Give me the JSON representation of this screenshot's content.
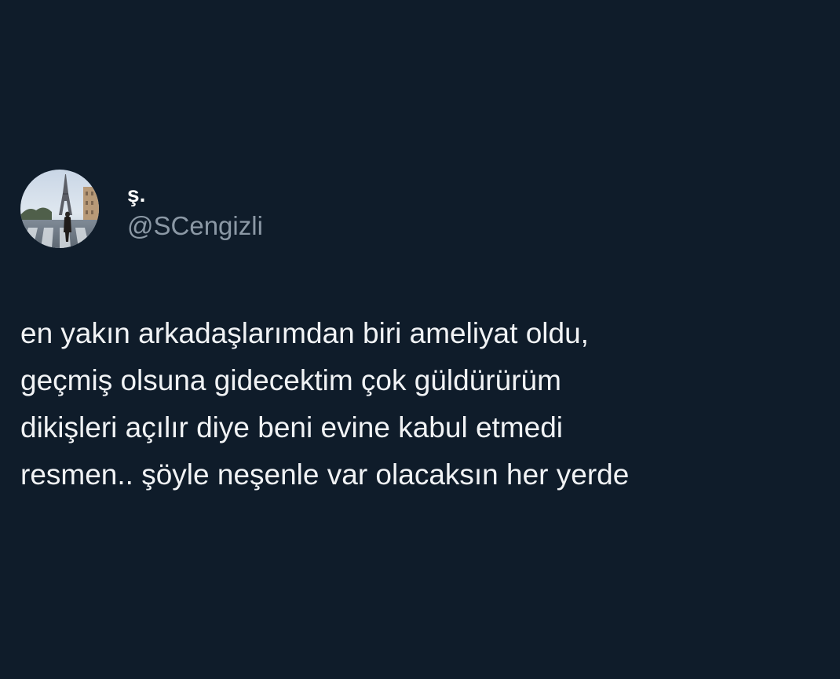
{
  "tweet": {
    "display_name": "ş.",
    "handle": "@SCengizli",
    "text": "en yakın arkadaşlarımdan biri ameliyat oldu,\ngeçmiş olsuna gidecektim çok güldürürüm\ndikişleri açılır diye beni evine kabul etmedi\nresmen.. şöyle neşenle var olacaksın her yerde"
  },
  "theme": {
    "background": "#0f1c2a",
    "text_color": "#f1f3f5",
    "handle_color": "#8b98a5"
  },
  "icons": {
    "avatar": "profile-photo-eiffel-tower"
  }
}
